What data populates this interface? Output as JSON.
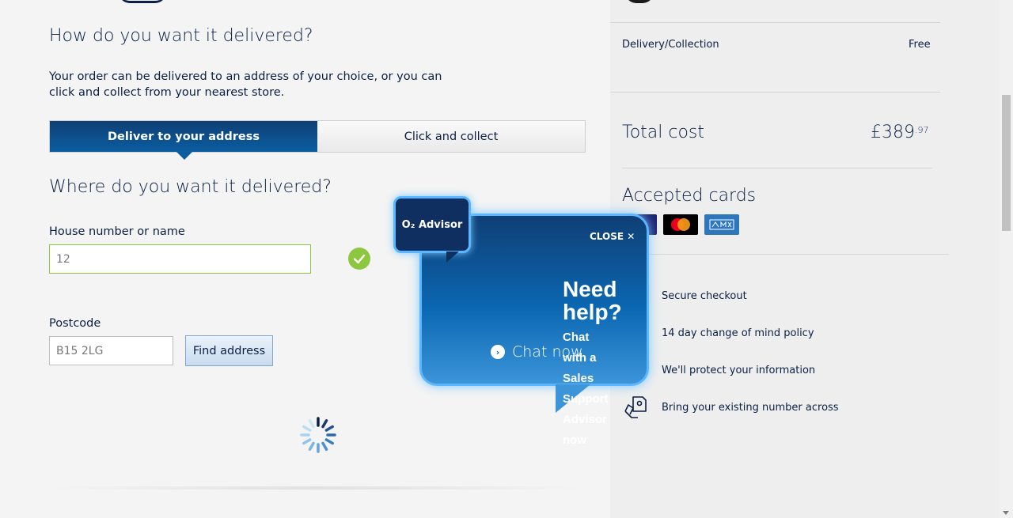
{
  "delivery": {
    "heading": "How do you want it delivered?",
    "intro": "Your order can be delivered to an address of your choice, or you can click and collect from your nearest store.",
    "tabs": [
      {
        "label": "Deliver to your address",
        "active": true
      },
      {
        "label": "Click and collect",
        "active": false
      }
    ]
  },
  "address": {
    "heading": "Where do you want it delivered?",
    "house_label": "House number or name",
    "house_value": "12",
    "postcode_label": "Postcode",
    "postcode_value": "B15 2LG",
    "find_button": "Find address"
  },
  "summary": {
    "delivery_label": "Delivery/Collection",
    "delivery_value": "Free",
    "total_label": "Total cost",
    "total_pounds": "£389",
    "total_pence": ".97",
    "cards_title": "Accepted cards",
    "cards": [
      "visa",
      "mastercard",
      "american-express"
    ],
    "features": [
      {
        "label": "Secure checkout",
        "icon": "lock-icon"
      },
      {
        "label": "14 day change of mind policy",
        "icon": "calendar-icon"
      },
      {
        "label": "We'll protect your information",
        "icon": "shield-icon"
      },
      {
        "label": "Bring your existing number across",
        "icon": "sim-transfer-icon"
      }
    ]
  },
  "chat": {
    "badge": "O₂ Advisor",
    "close": "CLOSE ✕",
    "need_help": "Need help?",
    "chat_with": "Chat with a Sales Support Advisor now",
    "chat_now": "Chat now"
  },
  "colors": {
    "navy": "#0b1f44",
    "accent_blue": "#0a5da1",
    "success_green": "#8dc63f",
    "panel_gray": "#eeeeee"
  }
}
